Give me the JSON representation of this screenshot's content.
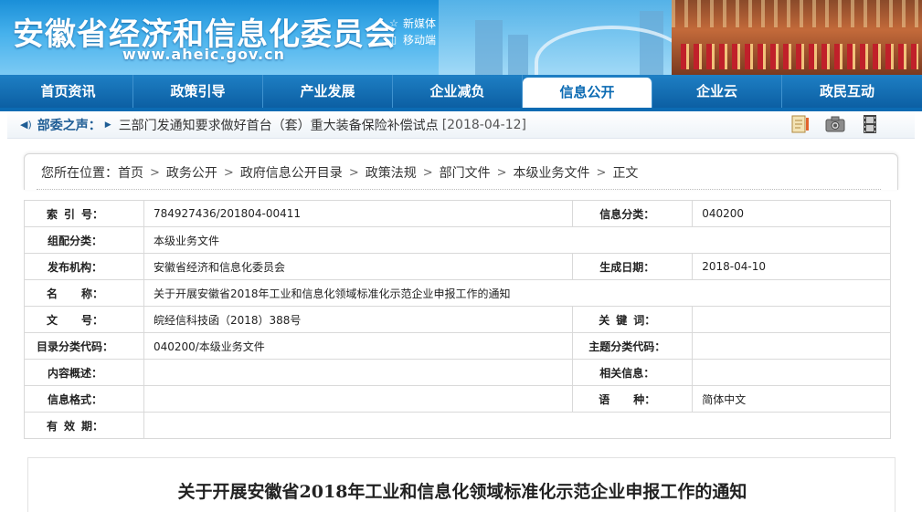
{
  "header": {
    "title": "安徽省经济和信息化委员会",
    "url": "www.aheic.gov.cn",
    "links": [
      {
        "icon": "star-icon",
        "label": "新媒体"
      },
      {
        "icon": "mobile-icon",
        "label": "移动端"
      }
    ]
  },
  "nav": {
    "items": [
      "首页资讯",
      "政策引导",
      "产业发展",
      "企业减负",
      "信息公开",
      "企业云",
      "政民互动"
    ],
    "active_index": 4
  },
  "ticker": {
    "label": "部委之声：",
    "news": "三部门发通知要求做好首台（套）重大装备保险补偿试点",
    "date": "[2018-04-12]",
    "tools": [
      "note-icon",
      "camera-icon",
      "film-icon"
    ]
  },
  "breadcrumb": {
    "prefix": "您所在位置：",
    "items": [
      "首页",
      "政务公开",
      "政府信息公开目录",
      "政策法规",
      "部门文件",
      "本级业务文件",
      "正文"
    ]
  },
  "info": {
    "index_label": [
      "索",
      "引",
      "号："
    ],
    "index_value": "784927436/201804-00411",
    "category_label": "信息分类：",
    "category_value": "040200",
    "group_label": "组配分类：",
    "group_value": "本级业务文件",
    "publisher_label": "发布机构：",
    "publisher_value": "安徽省经济和信息化委员会",
    "gen_date_label": "生成日期：",
    "gen_date_value": "2018-04-10",
    "name_label": [
      "名",
      "称："
    ],
    "name_value": "关于开展安徽省2018年工业和信息化领域标准化示范企业申报工作的通知",
    "docno_label": [
      "文",
      "号："
    ],
    "docno_value": "皖经信科技函（2018）388号",
    "keyword_label": [
      "关",
      "键",
      "词："
    ],
    "keyword_value": "",
    "catalog_label": "目录分类代码：",
    "catalog_value": "040200/本级业务文件",
    "topic_label": "主题分类代码：",
    "topic_value": "",
    "summary_label": "内容概述：",
    "summary_value": "",
    "related_label": "相关信息：",
    "related_value": "",
    "format_label": "信息格式：",
    "format_value": "",
    "lang_label": [
      "语",
      "种："
    ],
    "lang_value": "简体中文",
    "valid_label": [
      "有",
      "效",
      "期："
    ],
    "valid_value": ""
  },
  "article": {
    "title": "关于开展安徽省2018年工业和信息化领域标准化示范企业申报工作的通知"
  },
  "colors": {
    "nav_bg": "#0c5fa3",
    "nav_active_text": "#0c6bb3",
    "ticker_label": "#1f5d95"
  }
}
